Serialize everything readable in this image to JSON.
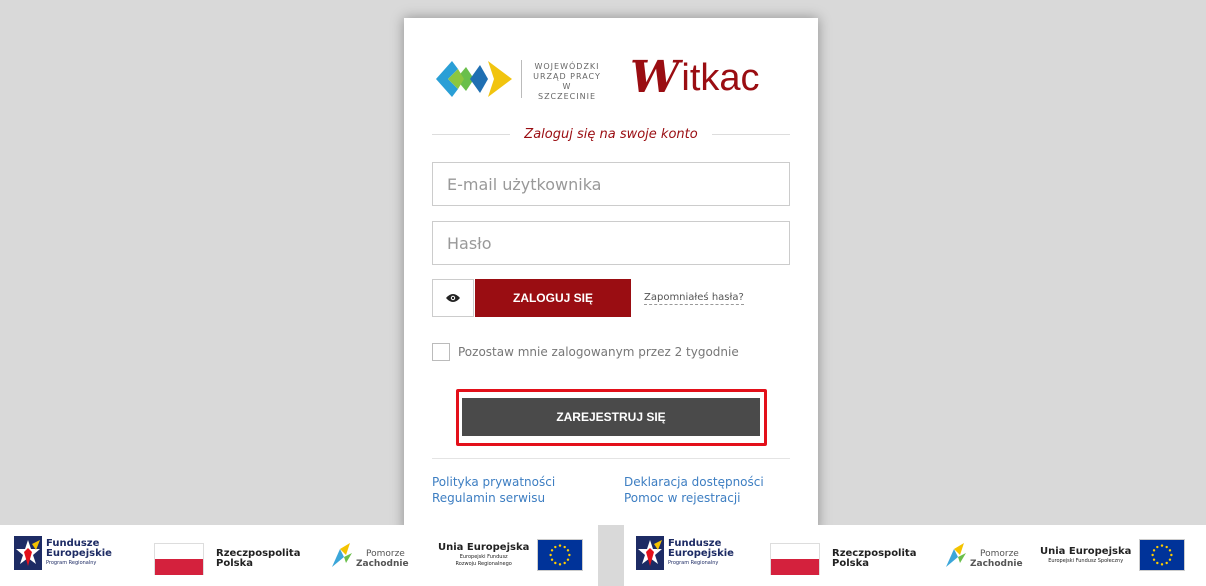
{
  "brand": {
    "wup_line1": "WOJEWÓDZKI",
    "wup_line2": "URZĄD PRACY",
    "wup_line3": "W SZCZECINIE",
    "witkac_first": "W",
    "witkac_rest": "itkac",
    "accent_color": "#9a0d12"
  },
  "form": {
    "heading": "Zaloguj się na swoje konto",
    "email_placeholder": "E-mail użytkownika",
    "email_value": "",
    "password_placeholder": "Hasło",
    "password_value": "",
    "eye_icon": "eye-icon",
    "login_label": "ZALOGUJ SIĘ",
    "forgot_label": "Zapomniałeś hasła?",
    "remember_label": "Pozostaw mnie zalogowanym przez 2 tygodnie",
    "remember_checked": false,
    "register_label": "ZAREJESTRUJ SIĘ"
  },
  "links": {
    "privacy": "Polityka prywatności",
    "terms": "Regulamin serwisu",
    "accessibility": "Deklaracja dostępności",
    "help": "Pomoc w rejestracji"
  },
  "footer_left": {
    "fe_line1": "Fundusze",
    "fe_line2": "Europejskie",
    "fe_line3": "Program Regionalny",
    "pl_line1": "Rzeczpospolita",
    "pl_line2": "Polska",
    "pz_line1": "Pomorze",
    "pz_line2": "Zachodnie",
    "ue_line1": "Unia Europejska",
    "ue_line2": "Europejski Fundusz",
    "ue_line3": "Rozwoju Regionalnego"
  },
  "footer_right": {
    "fe_line1": "Fundusze",
    "fe_line2": "Europejskie",
    "fe_line3": "Program Regionalny",
    "pl_line1": "Rzeczpospolita",
    "pl_line2": "Polska",
    "pz_line1": "Pomorze",
    "pz_line2": "Zachodnie",
    "ue_line1": "Unia Europejska",
    "ue_line2": "Europejski Fundusz Społeczny"
  }
}
